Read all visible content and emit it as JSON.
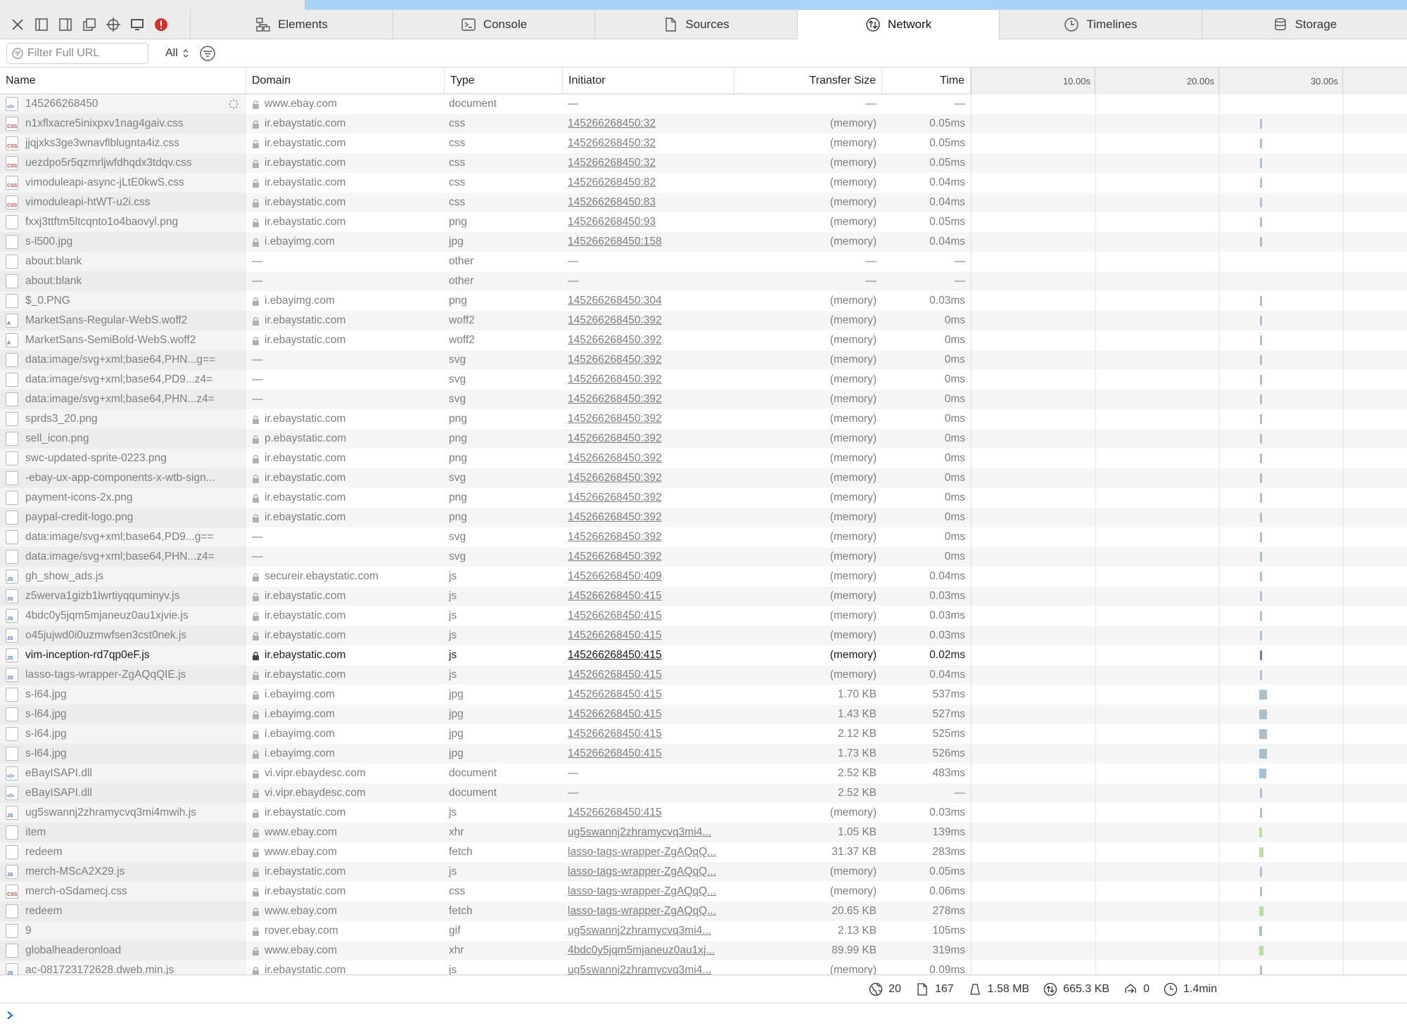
{
  "toolbar": {
    "tools": [
      "close-icon",
      "dock-bottom-icon",
      "dock-right-icon",
      "undock-icon",
      "inspect-icon",
      "device-icon",
      "error-icon"
    ],
    "tabs": [
      {
        "label": "Elements",
        "icon": "elements-icon"
      },
      {
        "label": "Console",
        "icon": "console-icon"
      },
      {
        "label": "Sources",
        "icon": "sources-icon"
      },
      {
        "label": "Network",
        "icon": "network-icon",
        "active": true
      },
      {
        "label": "Timelines",
        "icon": "timelines-icon"
      },
      {
        "label": "Storage",
        "icon": "storage-icon"
      }
    ]
  },
  "filter": {
    "placeholder": "Filter Full URL",
    "type_value": "All"
  },
  "columns": {
    "name": "Name",
    "domain": "Domain",
    "type": "Type",
    "initiator": "Initiator",
    "transfer_size": "Transfer Size",
    "time": "Time"
  },
  "waterfall": {
    "ticks": [
      "10.00s",
      "20.00s",
      "30.00s"
    ]
  },
  "colors": {
    "accent": "#1f6fe5",
    "load_strip": "#a9d3f7",
    "bar_css": "#a6bfe0",
    "bar_img": "#a9c0cc",
    "bar_fetch": "#b7dfa1",
    "error": "#d0312d"
  },
  "requests": [
    {
      "name": "145266268450",
      "icon": "doc",
      "domain": "www.ebay.com",
      "type": "document",
      "initiator": "—",
      "size": "—",
      "time": "—",
      "link": false,
      "spinner": true
    },
    {
      "name": "n1xflxacre5inixpxv1nag4gaiv.css",
      "icon": "css",
      "domain": "ir.ebaystatic.com",
      "type": "css",
      "initiator": "145266268450:32",
      "size": "(memory)",
      "time": "0.05ms",
      "link": true
    },
    {
      "name": "jjqjxks3ge3wnavflblugnta4iz.css",
      "icon": "css",
      "domain": "ir.ebaystatic.com",
      "type": "css",
      "initiator": "145266268450:32",
      "size": "(memory)",
      "time": "0.05ms",
      "link": true
    },
    {
      "name": "uezdpo5r5qzmrljwfdhqdx3tdqv.css",
      "icon": "css",
      "domain": "ir.ebaystatic.com",
      "type": "css",
      "initiator": "145266268450:32",
      "size": "(memory)",
      "time": "0.05ms",
      "link": true
    },
    {
      "name": "vimoduleapi-async-jLtE0kwS.css",
      "icon": "css",
      "domain": "ir.ebaystatic.com",
      "type": "css",
      "initiator": "145266268450:82",
      "size": "(memory)",
      "time": "0.04ms",
      "link": true
    },
    {
      "name": "vimoduleapi-htWT-u2i.css",
      "icon": "css",
      "domain": "ir.ebaystatic.com",
      "type": "css",
      "initiator": "145266268450:83",
      "size": "(memory)",
      "time": "0.04ms",
      "link": true
    },
    {
      "name": "fxxj3ttftm5ltcqnto1o4baovyl.png",
      "icon": "img",
      "domain": "ir.ebaystatic.com",
      "type": "png",
      "initiator": "145266268450:93",
      "size": "(memory)",
      "time": "0.05ms",
      "link": true
    },
    {
      "name": "s-l500.jpg",
      "icon": "img",
      "domain": "i.ebayimg.com",
      "type": "jpg",
      "initiator": "145266268450:158",
      "size": "(memory)",
      "time": "0.04ms",
      "link": true
    },
    {
      "name": "about:blank",
      "icon": "blank",
      "domain": "—",
      "type": "other",
      "initiator": "—",
      "size": "—",
      "time": "—",
      "link": false,
      "nolock": true
    },
    {
      "name": "about:blank",
      "icon": "blank",
      "domain": "—",
      "type": "other",
      "initiator": "—",
      "size": "—",
      "time": "—",
      "link": false,
      "nolock": true
    },
    {
      "name": "$_0.PNG",
      "icon": "img",
      "domain": "i.ebayimg.com",
      "type": "png",
      "initiator": "145266268450:304",
      "size": "(memory)",
      "time": "0.03ms",
      "link": true
    },
    {
      "name": "MarketSans-Regular-WebS.woff2",
      "icon": "font",
      "domain": "ir.ebaystatic.com",
      "type": "woff2",
      "initiator": "145266268450:392",
      "size": "(memory)",
      "time": "0ms",
      "link": true
    },
    {
      "name": "MarketSans-SemiBold-WebS.woff2",
      "icon": "font",
      "domain": "ir.ebaystatic.com",
      "type": "woff2",
      "initiator": "145266268450:392",
      "size": "(memory)",
      "time": "0ms",
      "link": true
    },
    {
      "name": "data:image/svg+xml;base64,PHN...g==",
      "icon": "img",
      "domain": "—",
      "type": "svg",
      "initiator": "145266268450:392",
      "size": "(memory)",
      "time": "0ms",
      "link": true,
      "nolock": true
    },
    {
      "name": "data:image/svg+xml;base64,PD9...z4=",
      "icon": "img",
      "domain": "—",
      "type": "svg",
      "initiator": "145266268450:392",
      "size": "(memory)",
      "time": "0ms",
      "link": true,
      "nolock": true
    },
    {
      "name": "data:image/svg+xml;base64,PHN...z4=",
      "icon": "img",
      "domain": "—",
      "type": "svg",
      "initiator": "145266268450:392",
      "size": "(memory)",
      "time": "0ms",
      "link": true,
      "nolock": true
    },
    {
      "name": "sprds3_20.png",
      "icon": "img",
      "domain": "ir.ebaystatic.com",
      "type": "png",
      "initiator": "145266268450:392",
      "size": "(memory)",
      "time": "0ms",
      "link": true
    },
    {
      "name": "sell_icon.png",
      "icon": "img",
      "domain": "p.ebaystatic.com",
      "type": "png",
      "initiator": "145266268450:392",
      "size": "(memory)",
      "time": "0ms",
      "link": true
    },
    {
      "name": "swc-updated-sprite-0223.png",
      "icon": "img",
      "domain": "ir.ebaystatic.com",
      "type": "png",
      "initiator": "145266268450:392",
      "size": "(memory)",
      "time": "0ms",
      "link": true
    },
    {
      "name": "-ebay-ux-app-components-x-wtb-sign...",
      "icon": "img",
      "domain": "ir.ebaystatic.com",
      "type": "svg",
      "initiator": "145266268450:392",
      "size": "(memory)",
      "time": "0ms",
      "link": true
    },
    {
      "name": "payment-icons-2x.png",
      "icon": "img",
      "domain": "ir.ebaystatic.com",
      "type": "png",
      "initiator": "145266268450:392",
      "size": "(memory)",
      "time": "0ms",
      "link": true
    },
    {
      "name": "paypal-credit-logo.png",
      "icon": "img",
      "domain": "ir.ebaystatic.com",
      "type": "png",
      "initiator": "145266268450:392",
      "size": "(memory)",
      "time": "0ms",
      "link": true
    },
    {
      "name": "data:image/svg+xml;base64,PD9...g==",
      "icon": "img",
      "domain": "—",
      "type": "svg",
      "initiator": "145266268450:392",
      "size": "(memory)",
      "time": "0ms",
      "link": true,
      "nolock": true
    },
    {
      "name": "data:image/svg+xml;base64,PHN...z4=",
      "icon": "img",
      "domain": "—",
      "type": "svg",
      "initiator": "145266268450:392",
      "size": "(memory)",
      "time": "0ms",
      "link": true,
      "nolock": true
    },
    {
      "name": "gh_show_ads.js",
      "icon": "js",
      "domain": "secureir.ebaystatic.com",
      "type": "js",
      "initiator": "145266268450:409",
      "size": "(memory)",
      "time": "0.04ms",
      "link": true
    },
    {
      "name": "z5werva1gizb1lwrtiyqquminyv.js",
      "icon": "js",
      "domain": "ir.ebaystatic.com",
      "type": "js",
      "initiator": "145266268450:415",
      "size": "(memory)",
      "time": "0.03ms",
      "link": true
    },
    {
      "name": "4bdc0y5jqm5mjaneuz0au1xjvie.js",
      "icon": "js",
      "domain": "ir.ebaystatic.com",
      "type": "js",
      "initiator": "145266268450:415",
      "size": "(memory)",
      "time": "0.03ms",
      "link": true
    },
    {
      "name": "o45jujwd0i0uzmwfsen3cst0nek.js",
      "icon": "js",
      "domain": "ir.ebaystatic.com",
      "type": "js",
      "initiator": "145266268450:415",
      "size": "(memory)",
      "time": "0.03ms",
      "link": true
    },
    {
      "name": "vim-inception-rd7qp0eF.js",
      "icon": "js",
      "domain": "ir.ebaystatic.com",
      "type": "js",
      "initiator": "145266268450:415",
      "size": "(memory)",
      "time": "0.02ms",
      "link": true,
      "selected": true
    },
    {
      "name": "lasso-tags-wrapper-ZgAQqQIE.js",
      "icon": "js",
      "domain": "ir.ebaystatic.com",
      "type": "js",
      "initiator": "145266268450:415",
      "size": "(memory)",
      "time": "0.04ms",
      "link": true
    },
    {
      "name": "s-l64.jpg",
      "icon": "img",
      "domain": "i.ebayimg.com",
      "type": "jpg",
      "initiator": "145266268450:415",
      "size": "1.70 KB",
      "time": "537ms",
      "link": true
    },
    {
      "name": "s-l64.jpg",
      "icon": "img",
      "domain": "i.ebayimg.com",
      "type": "jpg",
      "initiator": "145266268450:415",
      "size": "1.43 KB",
      "time": "527ms",
      "link": true
    },
    {
      "name": "s-l64.jpg",
      "icon": "img",
      "domain": "i.ebayimg.com",
      "type": "jpg",
      "initiator": "145266268450:415",
      "size": "2.12 KB",
      "time": "525ms",
      "link": true
    },
    {
      "name": "s-l64.jpg",
      "icon": "img",
      "domain": "i.ebayimg.com",
      "type": "jpg",
      "initiator": "145266268450:415",
      "size": "1.73 KB",
      "time": "526ms",
      "link": true
    },
    {
      "name": "eBayISAPI.dll",
      "icon": "doc",
      "domain": "vi.vipr.ebaydesc.com",
      "type": "document",
      "initiator": "—",
      "size": "2.52 KB",
      "time": "483ms",
      "link": false
    },
    {
      "name": "eBayISAPI.dll",
      "icon": "doc",
      "domain": "vi.vipr.ebaydesc.com",
      "type": "document",
      "initiator": "—",
      "size": "2.52 KB",
      "time": "—",
      "link": false
    },
    {
      "name": "ug5swannj2zhramycvq3mi4mwih.js",
      "icon": "js",
      "domain": "ir.ebaystatic.com",
      "type": "js",
      "initiator": "145266268450:415",
      "size": "(memory)",
      "time": "0.03ms",
      "link": true
    },
    {
      "name": "item",
      "icon": "blank",
      "domain": "www.ebay.com",
      "type": "xhr",
      "initiator": "ug5swannj2zhramycvq3mi4...",
      "size": "1.05 KB",
      "time": "139ms",
      "link": true
    },
    {
      "name": "redeem",
      "icon": "blank",
      "domain": "www.ebay.com",
      "type": "fetch",
      "initiator": "lasso-tags-wrapper-ZgAQqQ...",
      "size": "31.37 KB",
      "time": "283ms",
      "link": true
    },
    {
      "name": "merch-MScA2X29.js",
      "icon": "js",
      "domain": "ir.ebaystatic.com",
      "type": "js",
      "initiator": "lasso-tags-wrapper-ZgAQqQ...",
      "size": "(memory)",
      "time": "0.05ms",
      "link": true
    },
    {
      "name": "merch-oSdamecj.css",
      "icon": "css",
      "domain": "ir.ebaystatic.com",
      "type": "css",
      "initiator": "lasso-tags-wrapper-ZgAQqQ...",
      "size": "(memory)",
      "time": "0.06ms",
      "link": true
    },
    {
      "name": "redeem",
      "icon": "blank",
      "domain": "www.ebay.com",
      "type": "fetch",
      "initiator": "lasso-tags-wrapper-ZgAQqQ...",
      "size": "20.65 KB",
      "time": "278ms",
      "link": true
    },
    {
      "name": "9",
      "icon": "img",
      "domain": "rover.ebay.com",
      "type": "gif",
      "initiator": "ug5swannj2zhramycvq3mi4...",
      "size": "2.13 KB",
      "time": "105ms",
      "link": true
    },
    {
      "name": "globalheaderonload",
      "icon": "blank",
      "domain": "www.ebay.com",
      "type": "xhr",
      "initiator": "4bdc0y5jqm5mjaneuz0au1xj...",
      "size": "89.99 KB",
      "time": "319ms",
      "link": true
    },
    {
      "name": "ac-081723172628.dweb.min.js",
      "icon": "js",
      "domain": "ir.ebaystatic.com",
      "type": "js",
      "initiator": "ug5swannj2zhramycvq3mi4...",
      "size": "(memory)",
      "time": "0.09ms",
      "link": true
    }
  ],
  "status": {
    "domains": "20",
    "requests": "167",
    "resources_size": "1.58 MB",
    "transferred": "665.3 KB",
    "redirects": "0",
    "elapsed": "1.4min"
  }
}
